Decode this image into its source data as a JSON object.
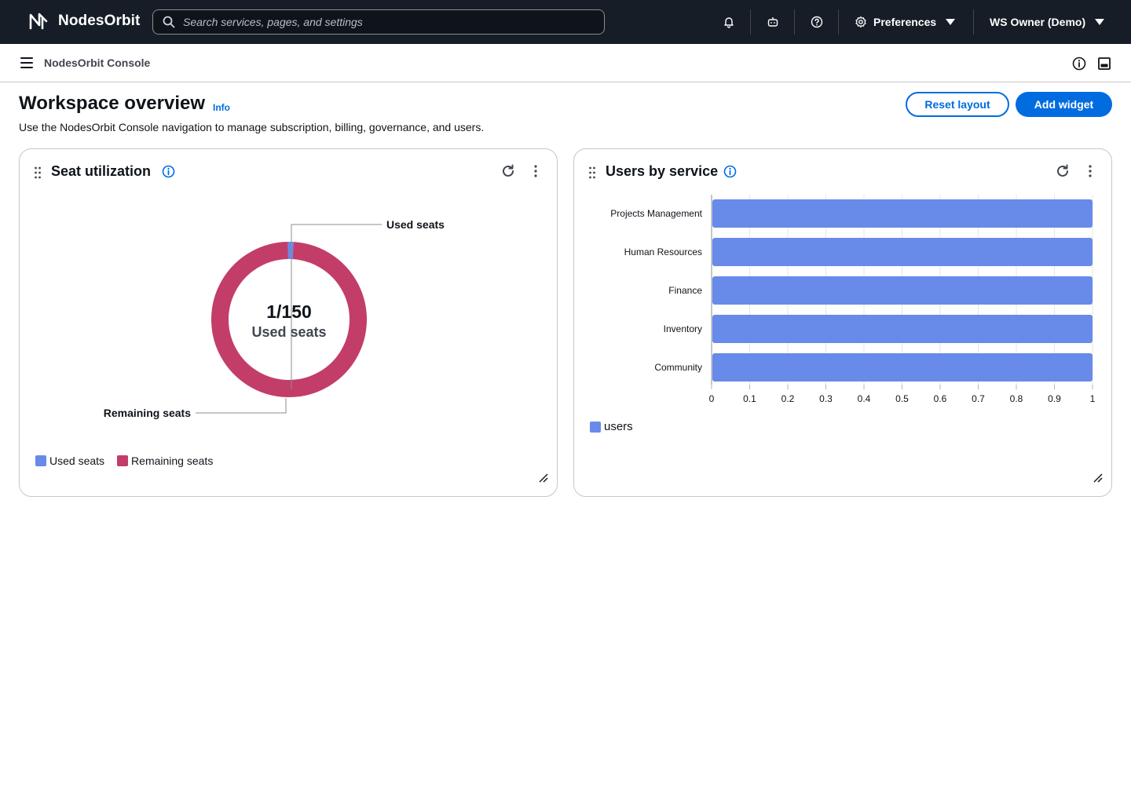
{
  "topnav": {
    "brand": "NodesOrbit",
    "search_placeholder": "Search services, pages, and settings",
    "preferences_label": "Preferences",
    "user_label": "WS Owner (Demo)"
  },
  "subbar": {
    "title": "NodesOrbit Console"
  },
  "header": {
    "title": "Workspace overview",
    "info_label": "Info",
    "description": "Use the NodesOrbit Console navigation to manage subscription, billing, governance, and users.",
    "reset_label": "Reset layout",
    "add_label": "Add widget"
  },
  "colors": {
    "used": "#688ae8",
    "remaining": "#c33d69",
    "accent": "#006ce0",
    "nav_bg": "#161d26"
  },
  "seat_widget": {
    "title": "Seat utilization",
    "center_value": "1/150",
    "center_label": "Used seats",
    "callout_used": "Used seats",
    "callout_remaining": "Remaining seats",
    "legend": [
      "Used seats",
      "Remaining seats"
    ]
  },
  "users_widget": {
    "title": "Users by service",
    "legend": [
      "users"
    ]
  },
  "chart_data": [
    {
      "type": "pie",
      "labels": [
        "Used seats",
        "Remaining seats"
      ],
      "values": [
        1,
        149
      ],
      "donut": true,
      "center_text": "1/150"
    },
    {
      "type": "bar",
      "orientation": "horizontal",
      "categories": [
        "Projects Management",
        "Human Resources",
        "Finance",
        "Inventory",
        "Community"
      ],
      "series": [
        {
          "name": "users",
          "values": [
            1,
            1,
            1,
            1,
            1
          ]
        }
      ],
      "xlim": [
        0,
        1
      ],
      "xticks": [
        "0",
        "0.1",
        "0.2",
        "0.3",
        "0.4",
        "0.5",
        "0.6",
        "0.7",
        "0.8",
        "0.9",
        "1"
      ],
      "grid": true,
      "legend_position": "bottom-left"
    }
  ]
}
